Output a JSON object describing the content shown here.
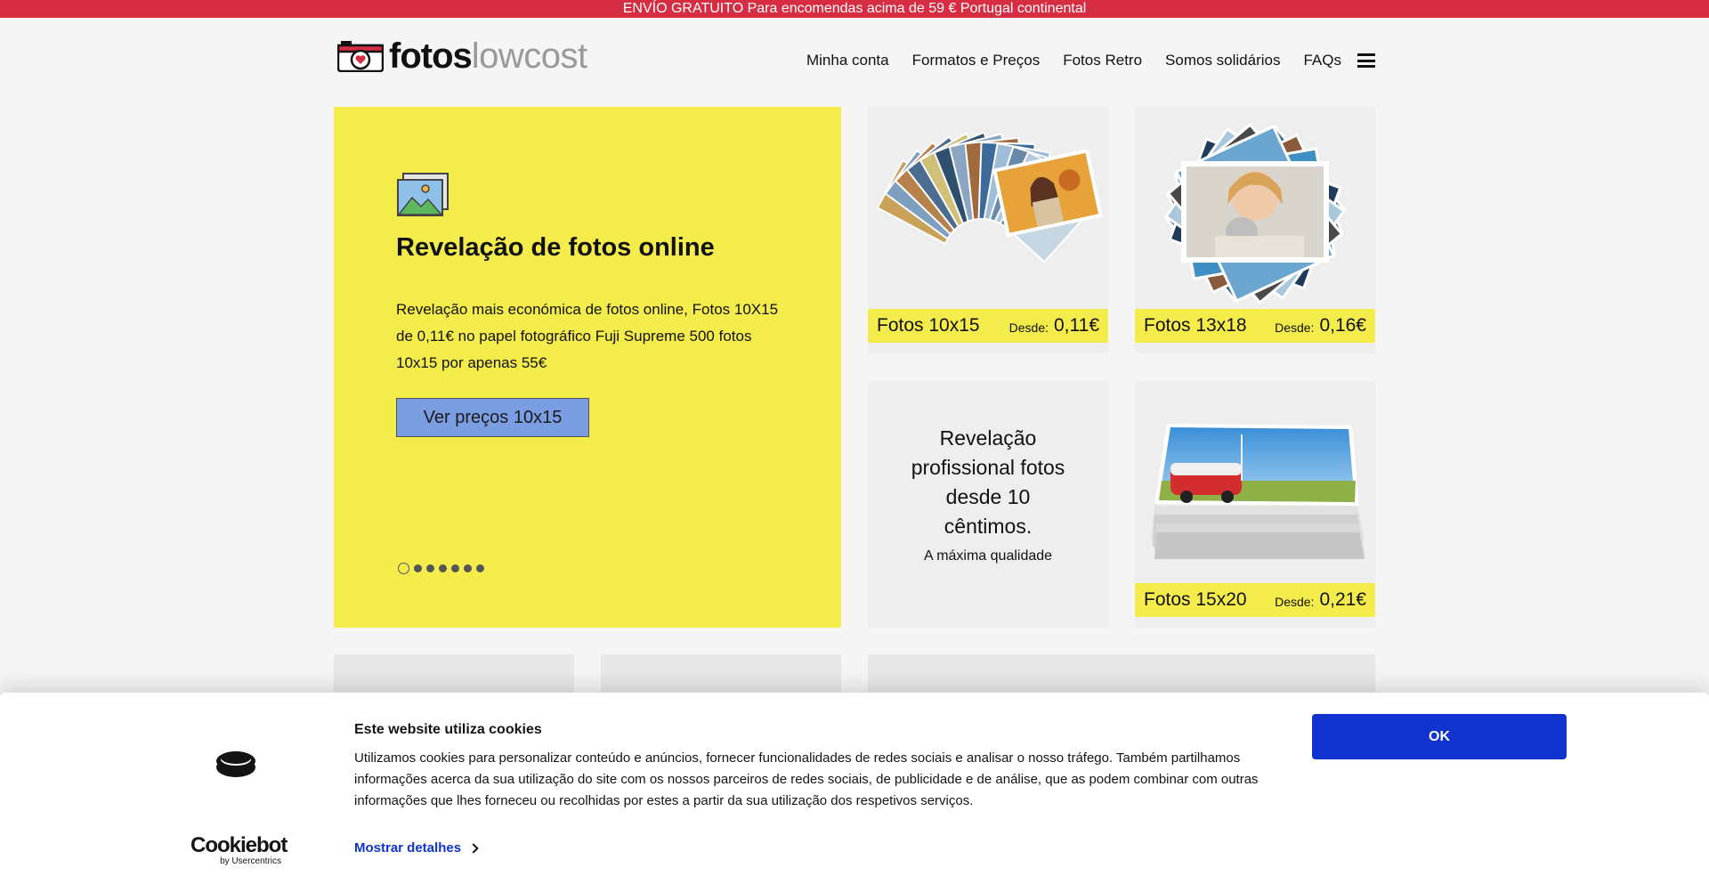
{
  "promo_bar": {
    "text": "ENVÍO GRATUITO Para encomendas acima de 59 € Portugal continental"
  },
  "logo": {
    "part_a": "fotos",
    "part_b": "lowcost"
  },
  "nav": {
    "items": [
      {
        "label": "Minha conta"
      },
      {
        "label": "Formatos e Preços"
      },
      {
        "label": "Fotos Retro"
      },
      {
        "label": "Somos solidários"
      },
      {
        "label": "FAQs"
      }
    ]
  },
  "hero": {
    "title": "Revelação de fotos online",
    "description": "Revelação mais económica de fotos online, Fotos 10X15 de 0,11€ no papel fotográfico Fuji Supreme 500 fotos 10x15 por apenas 55€",
    "button_label": "Ver preços 10x15",
    "slides_total": 7,
    "active_slide": 1
  },
  "tiles": [
    {
      "name": "Fotos 10x15",
      "from_label": "Desde:",
      "price": "0,11€"
    },
    {
      "name": "Fotos 13x18",
      "from_label": "Desde:",
      "price": "0,16€"
    },
    {
      "name": "Fotos 15x20",
      "from_label": "Desde:",
      "price": "0,21€"
    }
  ],
  "promo_tile": {
    "headline": "Revelação profissional fotos desde 10 cêntimos.",
    "subline": "A máxima qualidade"
  },
  "cookie_banner": {
    "title": "Este website utiliza cookies",
    "text": "Utilizamos cookies para personalizar conteúdo e anúncios, fornecer funcionalidades de redes sociais e analisar o nosso tráfego. Também partilhamos informações acerca da sua utilização do site com os nossos parceiros de redes sociais, de publicidade e de análise, que as podem combinar com outras informações que lhes forneceu ou recolhidas por estes a partir da sua utilização dos respetivos serviços.",
    "details_label": "Mostrar detalhes",
    "ok_label": "OK",
    "brand": "Cookiebot",
    "brand_sub": "by Usercentrics"
  },
  "colors": {
    "promo_red": "#d72d43",
    "accent_yellow": "#f4ec4a",
    "button_blue": "#7b9ee3",
    "cookie_blue": "#1032cf"
  }
}
